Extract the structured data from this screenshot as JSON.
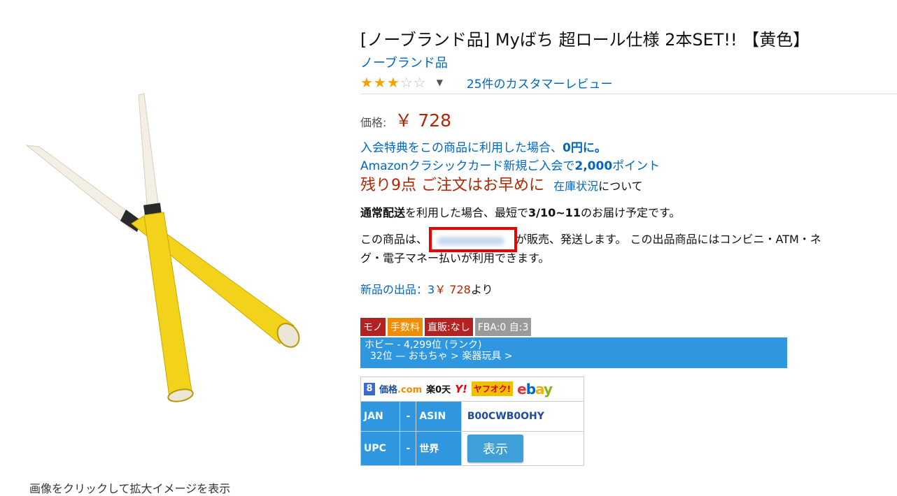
{
  "product": {
    "title": "[ノーブランド品] Myばち 超ロール仕様 2本SET!! 【黄色】",
    "brand": "ノーブランド品",
    "rating_stars": 3,
    "rating_max": 5,
    "review_link": "25件のカスタマーレビュー",
    "image_caption": "画像をクリックして拡大イメージを表示"
  },
  "price": {
    "label": "価格:",
    "value": "￥ 728"
  },
  "promo": {
    "line1_text": "入会特典をこの商品に利用した場合、",
    "line1_bold": "0円に。",
    "line2_text": "Amazonクラシックカード新規ご入会で",
    "line2_bold": "2,000",
    "line2_suffix": "ポイント"
  },
  "stock": {
    "warning": "残り9点 ご注文はお早めに",
    "link": "在庫状況",
    "suffix": "について"
  },
  "delivery": {
    "bold1": "通常配送",
    "text1": "を利用した場合、最短で",
    "bold2": "3/10~11",
    "text2": "のお届け予定です。"
  },
  "seller": {
    "prefix": "この商品は、",
    "suffix": "が販売、発送します。 この出品商品にはコンビニ・ATM・ネ",
    "line2": "グ・電子マネー払いが利用できます。"
  },
  "new_offers": {
    "label": "新品の出品：3",
    "price": "￥ 728",
    "suffix": "より"
  },
  "tags": {
    "mono": "モノ",
    "fee": "手数料",
    "direct": "直販:なし",
    "fba": "FBA:0  自:3"
  },
  "ranking": {
    "line1": "ホビー - 4,299位 (ランク)",
    "line2": "32位 — おもちゃ > 楽器玩具 >"
  },
  "tools": {
    "logo_g": "8",
    "logo_kakaku": "価格",
    "logo_kakaku_com": ".com",
    "logo_rakuten": "楽0天",
    "logo_yahoo": "Y!",
    "logo_yafuoku": "ヤフオク!",
    "logo_ebay": [
      "e",
      "b",
      "a",
      "y"
    ],
    "jan_label": "JAN",
    "jan_dash": "-",
    "asin_label": "ASIN",
    "asin_value": "B00CWB0OHY",
    "upc_label": "UPC",
    "upc_dash": "-",
    "world_label": "世界",
    "show_button": "表示"
  },
  "colors": {
    "link": "#0066c0",
    "price": "#b12704",
    "star": "#f0a400",
    "rank_bar": "#2f96e0",
    "highlight_box": "#ee0000"
  }
}
